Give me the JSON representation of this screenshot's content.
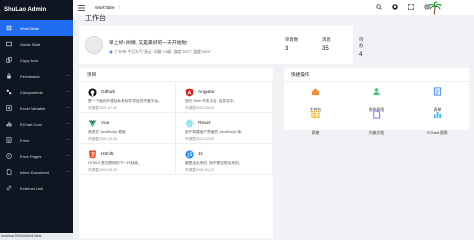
{
  "sidebar": {
    "logo": "ShuLao Admin",
    "items": [
      {
        "label": "WorkTable",
        "icon": "dashboard-icon",
        "active": true
      },
      {
        "label": "Guide Start",
        "icon": "guide-icon"
      },
      {
        "label": "Copy Icon",
        "icon": "copy-icon"
      },
      {
        "label": "Permission",
        "icon": "lock-icon"
      },
      {
        "label": "Components",
        "icon": "component-icon"
      },
      {
        "label": "Excel Variable",
        "icon": "excel-icon"
      },
      {
        "label": "EChart Cool",
        "icon": "chart-icon"
      },
      {
        "label": "Form",
        "icon": "form-icon"
      },
      {
        "label": "Error Pages",
        "icon": "error-icon"
      },
      {
        "label": "Inline Document",
        "icon": "document-icon"
      },
      {
        "label": "External Link",
        "icon": "link-icon"
      }
    ]
  },
  "status_url": "localhost:9991/#/WorkTable",
  "header": {
    "breadcrumb": "WorkTable",
    "separator": "/"
  },
  "welcome": {
    "title": "工作台",
    "greeting": "早上好! 树懒, 又是美好的一天开始啦!",
    "location": "广州市  今日天气\"多云\" 风级\"<3级\" 温度\"26℃\" 湿度\"94%\"",
    "stats": [
      {
        "label": "项目数",
        "value": "3"
      },
      {
        "label": "消息",
        "value": "35"
      },
      {
        "label": "待办",
        "value": "4"
      }
    ]
  },
  "projects": {
    "title": "项目",
    "items": [
      {
        "name": "Github",
        "desc": "是一个面向开源及私有软件项目的托管平台。",
        "date": "开源君2021-07-10",
        "icon": "github-icon",
        "color": "#111111"
      },
      {
        "name": "Angular",
        "desc": "现代 Web 开发平台, 百发百中。",
        "date": "开源君2022-03-09",
        "icon": "angular-icon",
        "color": "#dd1b16"
      },
      {
        "name": "Vue",
        "desc": "渐进式 JavaScript 框架",
        "date": "开源君2021-10-25",
        "icon": "vue-icon",
        "color": "#42b883"
      },
      {
        "name": "React",
        "desc": "用于构建用户界面的 JavaScript 库。",
        "date": "开源君2022-03-09",
        "icon": "react-icon",
        "color": "#61dafb"
      },
      {
        "name": "Html5",
        "desc": "HTML5 是互联网的下一代标准。",
        "date": "开源君2022-05-19",
        "icon": "html5-icon",
        "color": "#e34f26"
      },
      {
        "name": "Js",
        "desc": "路是走出来的, 而不是空想出来的。",
        "date": "开源君2022-04-23",
        "icon": "js-icon",
        "color": "#1e90ff"
      }
    ]
  },
  "quick": {
    "title": "快捷操作",
    "items": [
      {
        "label": "主控台",
        "icon": "home-icon",
        "color": "#f08c3a"
      },
      {
        "label": "角色权限",
        "icon": "role-icon",
        "color": "#49c77f"
      },
      {
        "label": "表单",
        "icon": "form-icon",
        "color": "#3b82f6"
      },
      {
        "label": "表格",
        "icon": "table-icon",
        "color": "#f0b429"
      },
      {
        "label": "内嵌文档",
        "icon": "document-icon",
        "color": "#7d5bf6"
      },
      {
        "label": "EChart 图表",
        "icon": "chart-icon",
        "color": "#38bdf8"
      }
    ]
  }
}
